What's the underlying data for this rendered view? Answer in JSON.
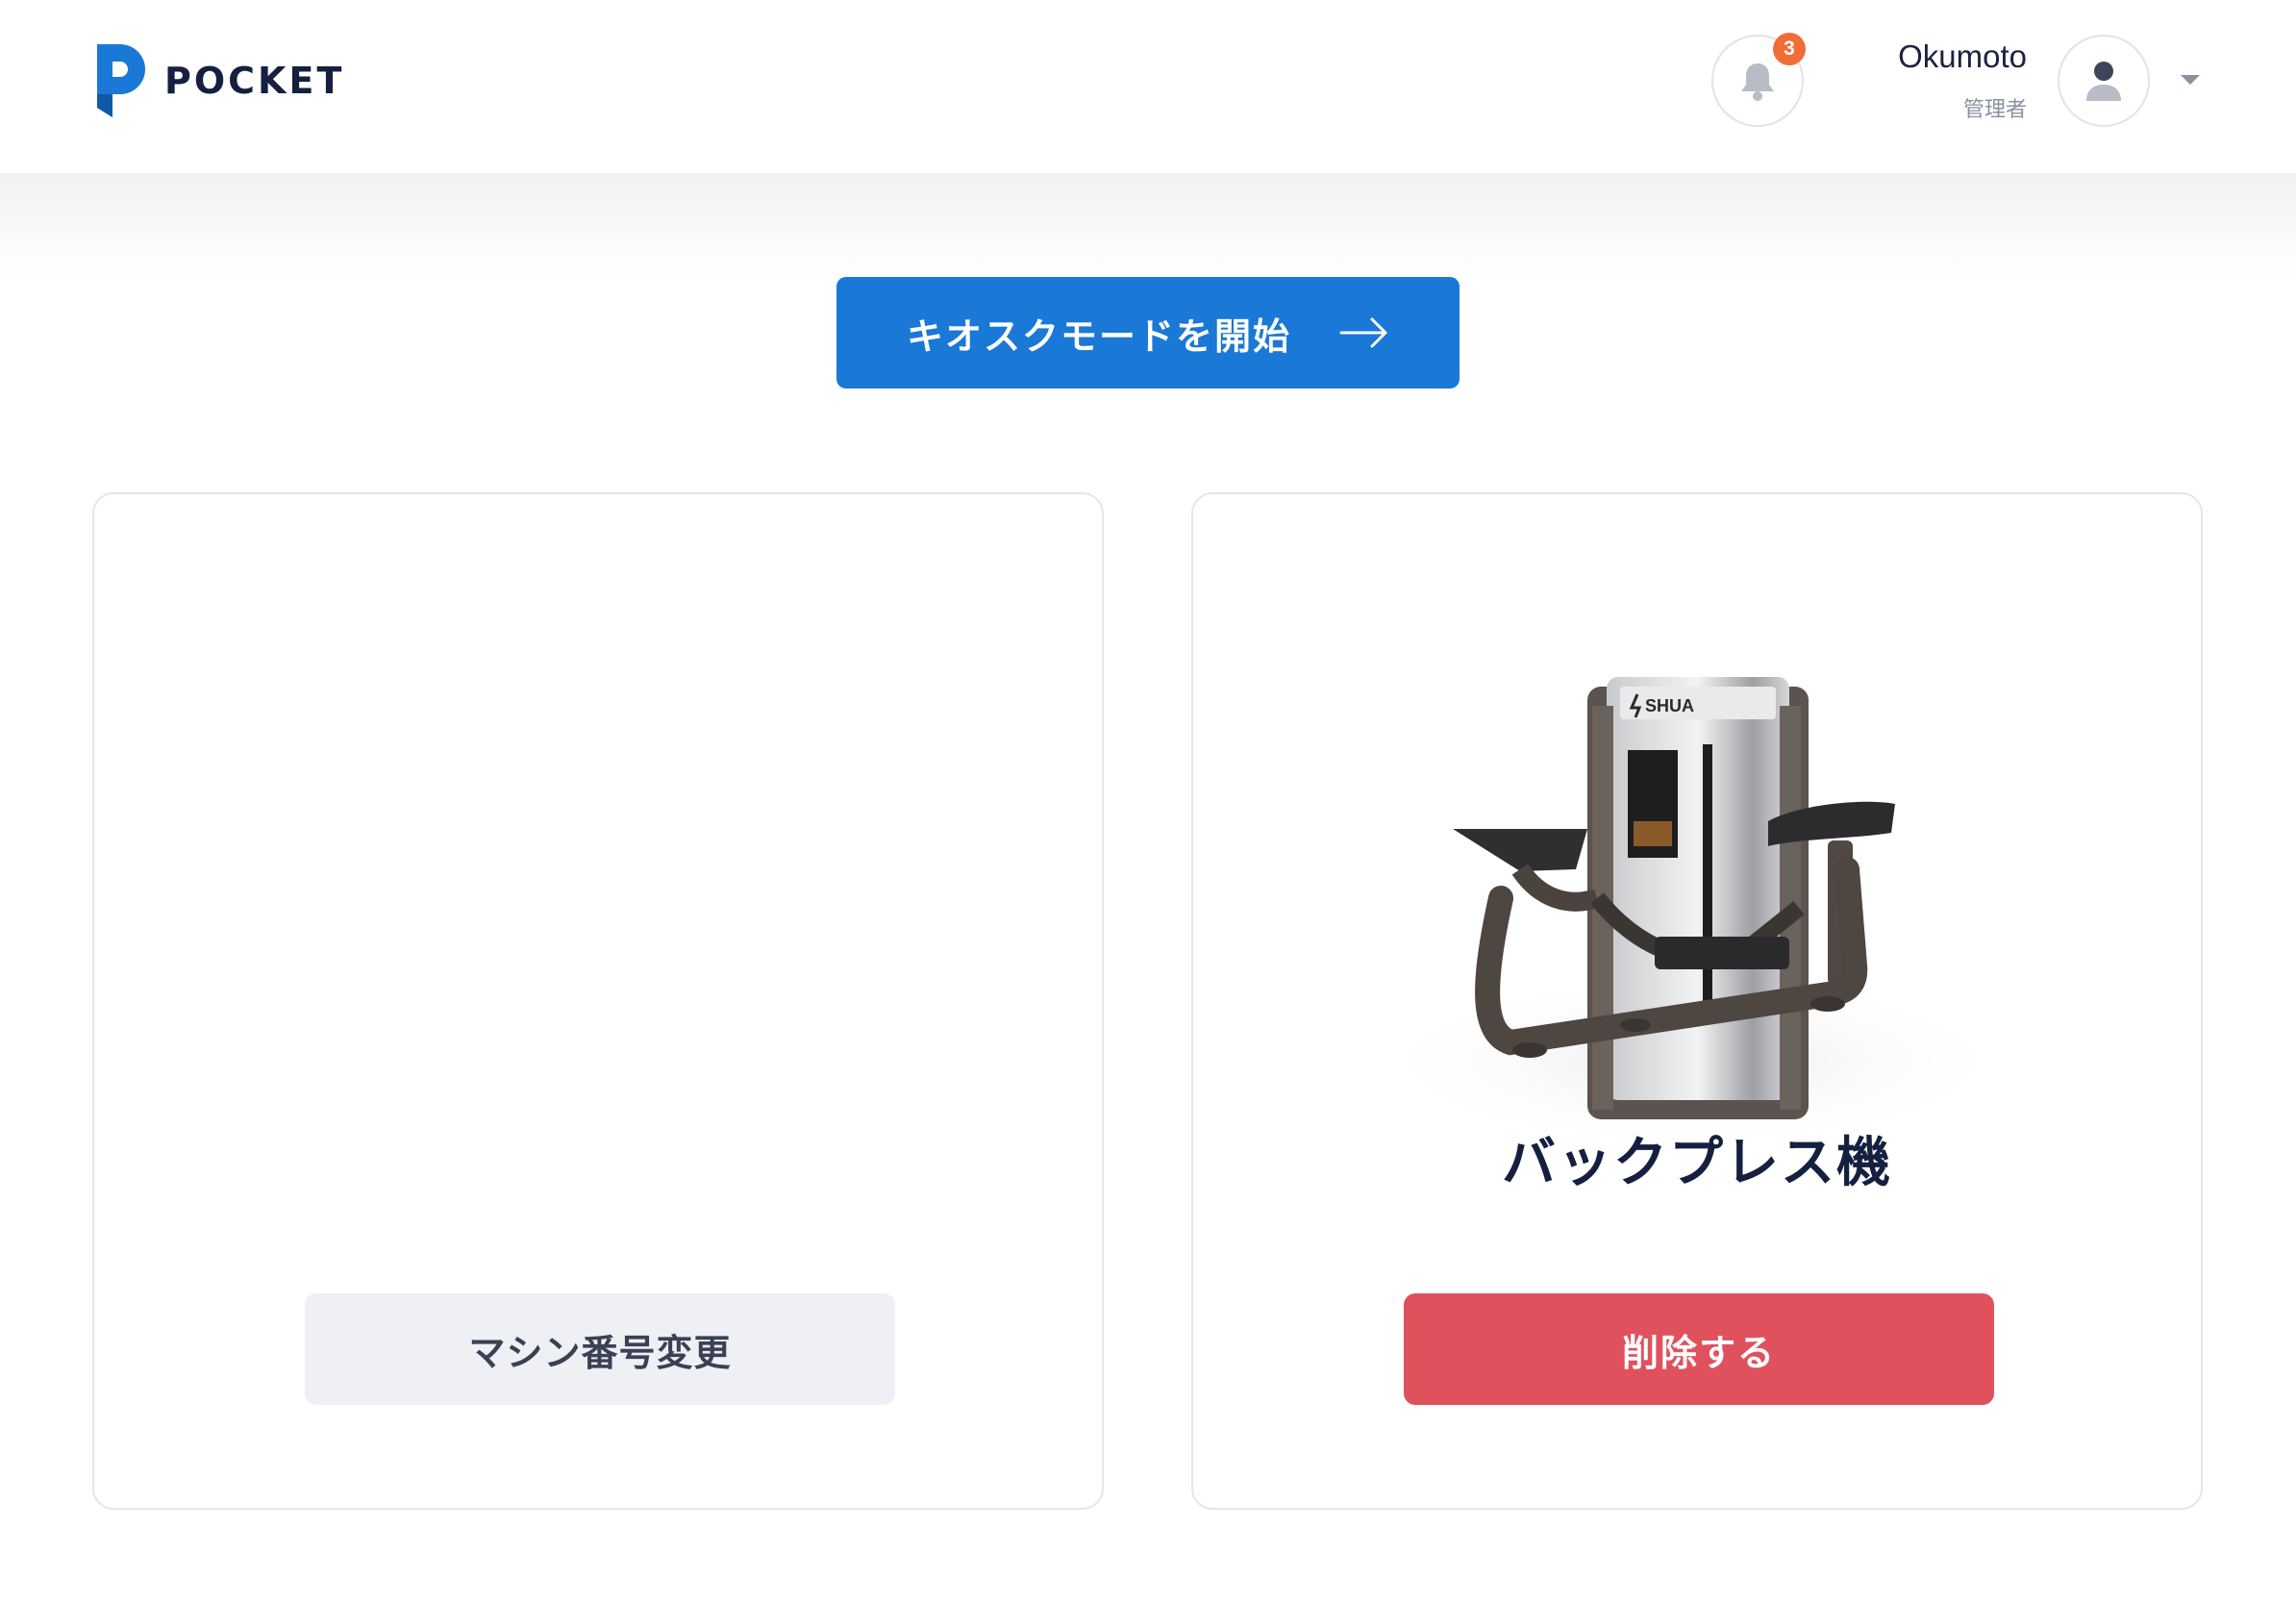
{
  "app": {
    "brand_name": "POCKET",
    "brand_color": "#1a78d6",
    "logo_icon": "pocket-p-logo"
  },
  "header": {
    "notifications": {
      "icon": "bell-icon",
      "count": "3"
    },
    "user": {
      "name": "Okumoto",
      "role": "管理者",
      "avatar_icon": "user-avatar-icon",
      "menu_icon": "caret-down-icon"
    }
  },
  "kiosk": {
    "label": "キオスクモードを開始",
    "icon": "arrow-right-icon"
  },
  "cards": [
    {
      "button_label": "マシン番号変更"
    },
    {
      "machine_name": "バックプレス機",
      "image_brand": "SHUA",
      "button_label": "削除する",
      "button_color": "#e0515e"
    }
  ]
}
